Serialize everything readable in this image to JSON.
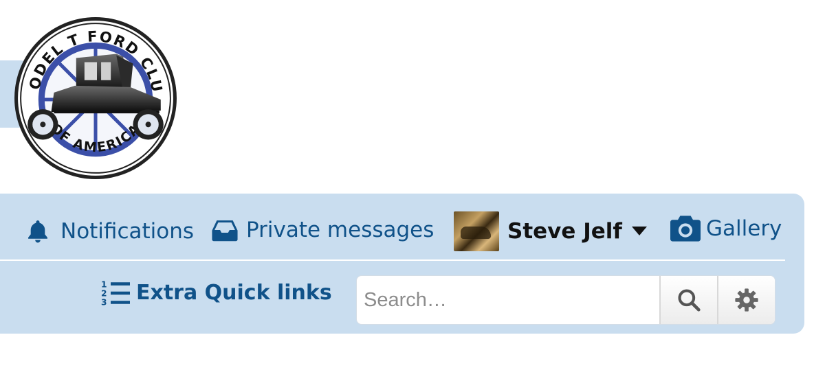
{
  "logo": {
    "name": "model-t-ford-club-of-america-logo",
    "top_text": "MODEL T FORD CLUB",
    "bottom_text": "OF AMERICA"
  },
  "nav": {
    "notifications": {
      "label": "Notifications",
      "icon": "bell-icon"
    },
    "private_messages": {
      "label": "Private messages",
      "icon": "inbox-icon"
    },
    "user": {
      "name": "Steve Jelf",
      "icon": "caret-down-icon"
    },
    "gallery": {
      "label": "Gallery",
      "icon": "camera-icon"
    },
    "quick_links": {
      "label": "Extra Quick links",
      "icon": "numbered-list-icon"
    }
  },
  "search": {
    "placeholder": "Search…",
    "value": "",
    "search_icon": "search-icon",
    "settings_icon": "gear-icon"
  },
  "colors": {
    "navbar_bg": "#c9ddef",
    "link": "#105289",
    "username": "#111111"
  }
}
